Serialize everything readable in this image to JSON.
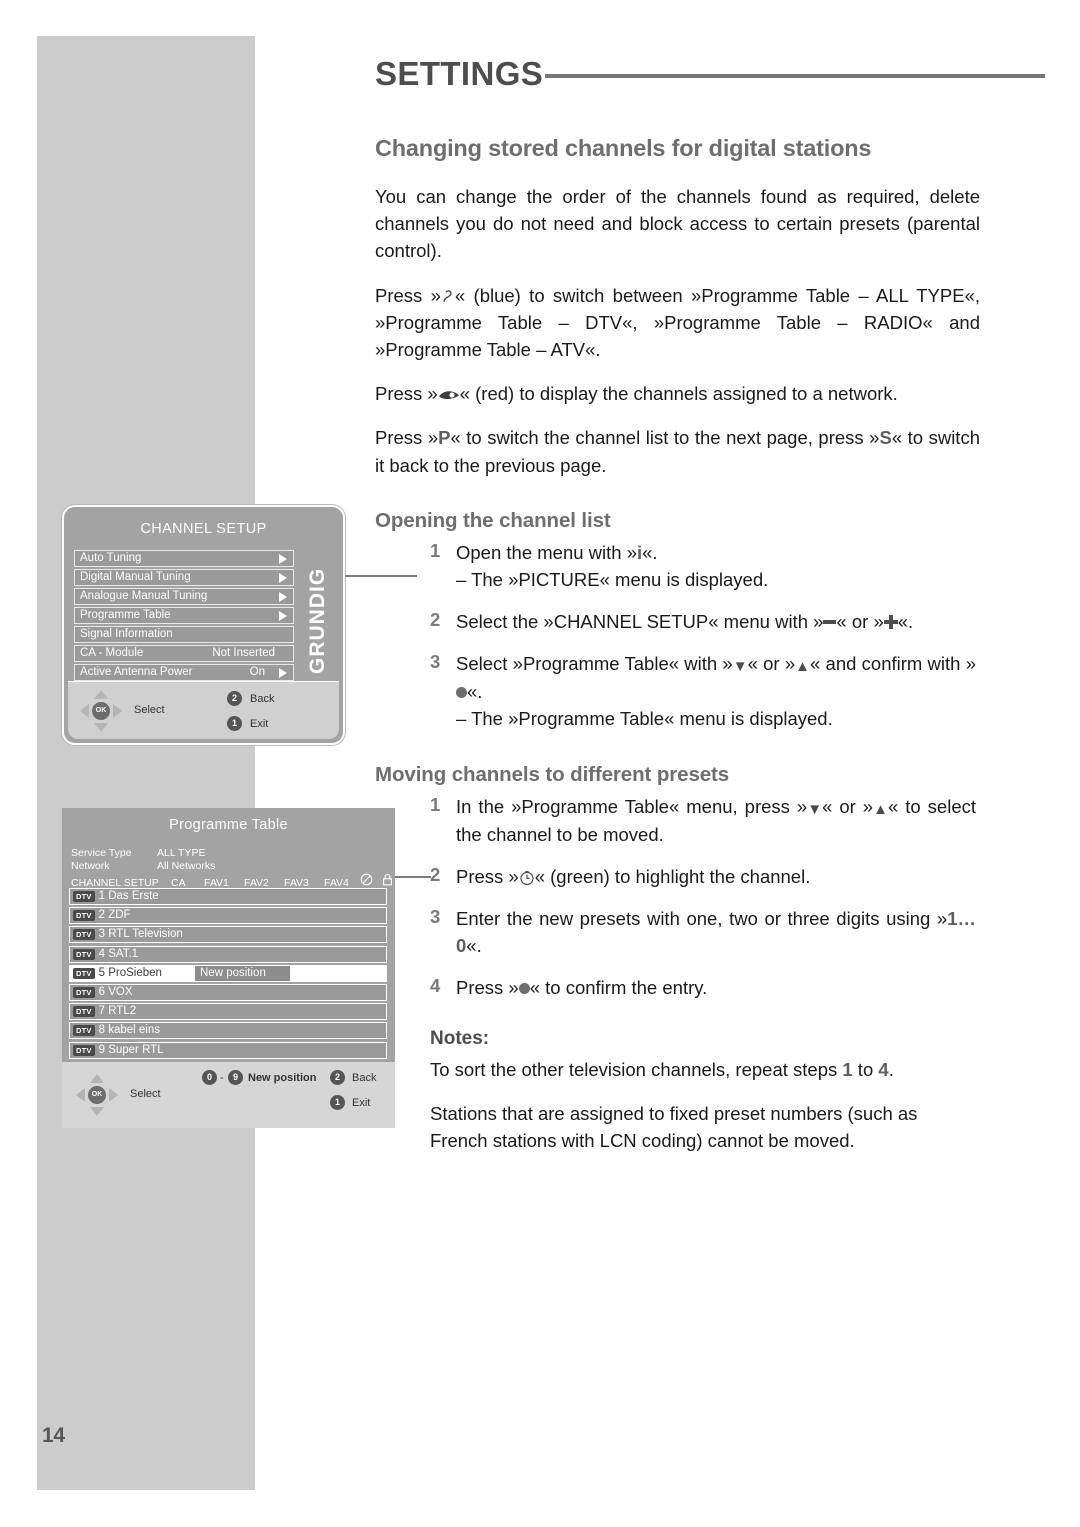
{
  "page": {
    "number": "14",
    "chapter_title": "SETTINGS"
  },
  "main": {
    "section_title": "Changing stored channels for digital stations",
    "intro": "You can change the order of the channels found as required, delete channels you do not need and block access to certain presets (parental control).",
    "para_blue_a": "Press »",
    "para_blue_b": "« (blue) to switch between »Programme Table – ALL TYPE«, »Programme Table – DTV«, »Programme Table – RADIO« and »Programme Table – ATV«.",
    "para_red_a": "Press »",
    "para_red_b": "« (red) to display the channels assigned to a network.",
    "para_ps_a": "Press »",
    "para_ps_b": "« to switch the channel list to the next page, press »",
    "para_ps_c": "« to switch it back to the previous page.",
    "key_p": "P",
    "key_s": "S",
    "opening": {
      "title": "Opening the channel list",
      "steps": [
        {
          "num": "1",
          "text_a": "Open the menu with »",
          "key": "i",
          "text_b": "«.",
          "dash": "– The »PICTURE« menu is displayed."
        },
        {
          "num": "2",
          "text_a": "Select the »CHANNEL SETUP« menu with »",
          "text_b": "« or »",
          "text_c": "«."
        },
        {
          "num": "3",
          "text_a": "Select »Programme Table« with »",
          "text_b": "« or »",
          "text_c": "« and confirm with »",
          "text_d": "«.",
          "dash": "– The »Programme Table« menu is displayed."
        }
      ]
    },
    "moving": {
      "title": "Moving channels to different presets",
      "steps": [
        {
          "num": "1",
          "text_a": "In the »Programme Table« menu, press »",
          "text_b": "« or »",
          "text_c": "« to select the channel to be moved."
        },
        {
          "num": "2",
          "text_a": "Press »",
          "text_b": "« (green) to highlight the channel."
        },
        {
          "num": "3",
          "text_a": "Enter the new presets with one, two or three digits using »",
          "key": "1…0",
          "text_b": "«."
        },
        {
          "num": "4",
          "text_a": "Press »",
          "text_b": "« to confirm the entry."
        }
      ]
    },
    "notes": {
      "heading": "Notes:",
      "note_1_a": "To sort the other television channels, repeat steps ",
      "note_1_n1": "1",
      "note_1_b": " to ",
      "note_1_n2": "4",
      "note_1_c": ".",
      "note_2": "Stations that are assigned to fixed preset numbers (such as French stations with LCN coding) cannot be moved."
    }
  },
  "osd_channel_setup": {
    "title": "CHANNEL SETUP",
    "brand": "GRUNDIG",
    "rows": [
      {
        "label": "Auto Tuning",
        "value": "",
        "arrow": true
      },
      {
        "label": "Digital Manual Tuning",
        "value": "",
        "arrow": true
      },
      {
        "label": "Analogue Manual Tuning",
        "value": "",
        "arrow": true
      },
      {
        "label": "Programme Table",
        "value": "",
        "arrow": true
      },
      {
        "label": "Signal Information",
        "value": "",
        "arrow": false
      },
      {
        "label": "CA - Module",
        "value": "Not Inserted",
        "arrow": false
      },
      {
        "label": "Active Antenna Power",
        "value": "On",
        "arrow": true
      }
    ],
    "footer": {
      "ok_label": "OK",
      "select": "Select",
      "back_key": "2",
      "back": "Back",
      "exit_key": "1",
      "exit": "Exit"
    }
  },
  "osd_programme_table": {
    "title": "Programme Table",
    "meta": [
      {
        "key": "Service Type",
        "value": "ALL TYPE"
      },
      {
        "key": "Network",
        "value": "All Networks"
      }
    ],
    "columns_label": "CHANNEL SETUP",
    "columns": [
      "CA",
      "FAV1",
      "FAV2",
      "FAV3",
      "FAV4"
    ],
    "column_icons": [
      "no-entry-icon",
      "lock-icon"
    ],
    "rows": [
      {
        "badge": "DTV",
        "text": "1 Das Erste",
        "selected": false
      },
      {
        "badge": "DTV",
        "text": "2 ZDF",
        "selected": false
      },
      {
        "badge": "DTV",
        "text": "3 RTL Television",
        "selected": false
      },
      {
        "badge": "DTV",
        "text": "4 SAT.1",
        "selected": false
      },
      {
        "badge": "DTV",
        "text": "5 ProSieben",
        "selected": true,
        "overlay": "New position"
      },
      {
        "badge": "DTV",
        "text": "6 VOX",
        "selected": false
      },
      {
        "badge": "DTV",
        "text": "7 RTL2",
        "selected": false
      },
      {
        "badge": "DTV",
        "text": "8 kabel eins",
        "selected": false
      },
      {
        "badge": "DTV",
        "text": "9 Super RTL",
        "selected": false
      }
    ],
    "footer": {
      "ok_label": "OK",
      "select": "Select",
      "np_from": "0",
      "np_dash": "-",
      "np_to": "9",
      "np_label": "New position",
      "back_key": "2",
      "back": "Back",
      "exit_key": "1",
      "exit": "Exit"
    }
  },
  "colors": {
    "band": "#cccccc",
    "heading": "#6e6e6e",
    "rule": "#777777",
    "osd_bg": "#a3a3a3",
    "osd_row": "#9a9a9a",
    "osd_foot": "#d6d6d6"
  }
}
